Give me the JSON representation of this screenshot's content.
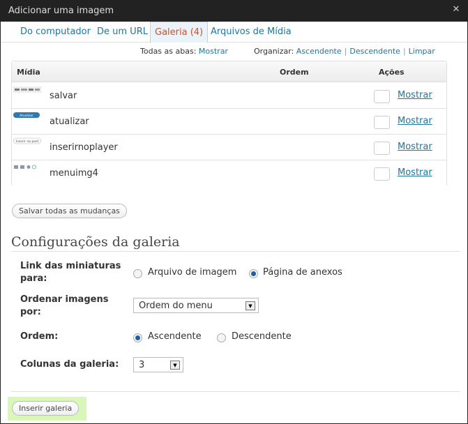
{
  "window": {
    "title": "Adicionar uma imagem"
  },
  "tabs": [
    {
      "label": "Do computador"
    },
    {
      "label": "De um URL"
    },
    {
      "label": "Galeria (4)",
      "active": true
    },
    {
      "label": "Arquivos de Mídia"
    }
  ],
  "toolbar": {
    "all_tabs_label": "Todas as abas:",
    "all_tabs_show": "Mostrar",
    "sort_label": "Organizar:",
    "ascending": "Ascendente",
    "descending": "Descendente",
    "clear": "Limpar",
    "separator": "|"
  },
  "media_table": {
    "headers": [
      "Mídia",
      "Ordem",
      "Ações"
    ],
    "rows": [
      {
        "title": "salvar",
        "action": "Mostrar"
      },
      {
        "title": "atualizar",
        "action": "Mostrar"
      },
      {
        "title": "inserirnoplayer",
        "action": "Mostrar"
      },
      {
        "title": "menuimg4",
        "action": "Mostrar"
      }
    ],
    "thumb_texts": [
      "Atualizar",
      "Inserir no post"
    ]
  },
  "save_all_button": "Salvar todas as mudanças",
  "gallery_settings": {
    "title": "Configurações da galeria",
    "link_label_1": "Link das miniaturas",
    "link_label_2": "para:",
    "link_options": [
      "Arquivo de imagem",
      "Página de anexos"
    ],
    "link_selected": 1,
    "orderby_label_1": "Ordenar imagens",
    "orderby_label_2": "por:",
    "orderby_value": "Ordem do menu",
    "order_label": "Ordem:",
    "order_options": [
      "Ascendente",
      "Descendente"
    ],
    "order_selected": 0,
    "columns_label": "Colunas da galeria:",
    "columns_value": "3"
  },
  "insert_button": "Inserir galeria",
  "colors": {
    "link": "#21759b",
    "active_tab": "#d54e21",
    "highlight": "#d8f7b9"
  }
}
